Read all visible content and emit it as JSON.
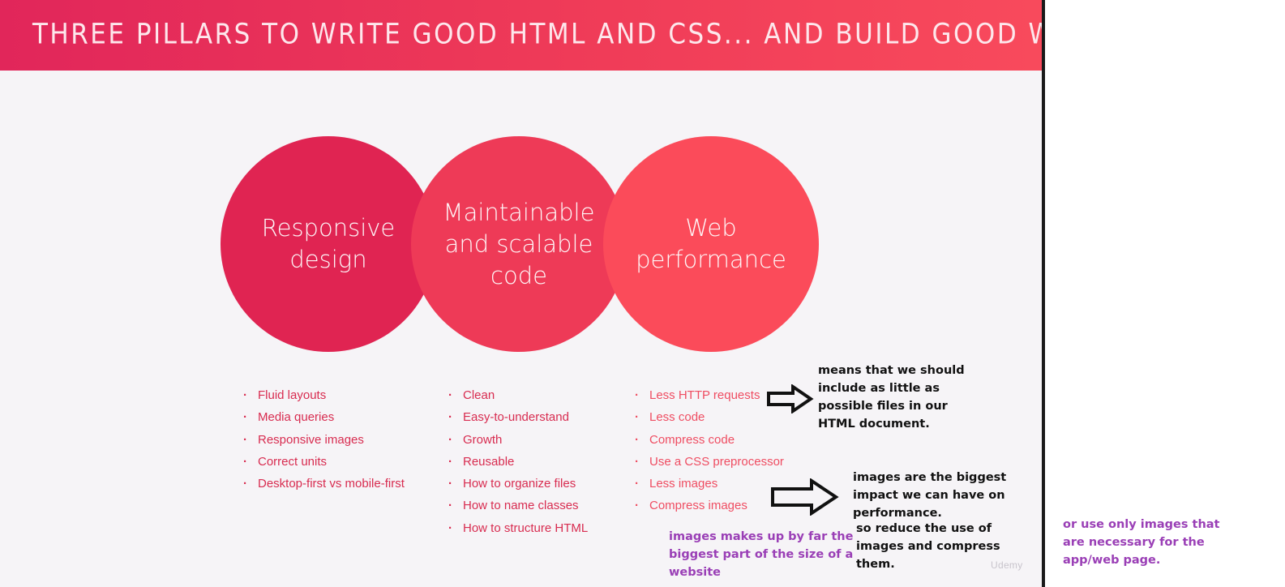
{
  "slide": {
    "title": "Three pillars to write good HTML and CSS... and build good websites",
    "watermark": "Udemy"
  },
  "pillars": [
    {
      "title": "Responsive\ndesign",
      "color": "#e02452",
      "items": [
        "Fluid layouts",
        "Media queries",
        "Responsive images",
        "Correct units",
        "Desktop-first vs mobile-first"
      ]
    },
    {
      "title": "Maintainable\nand scalable\ncode",
      "color": "#ee3a57",
      "items": [
        "Clean",
        "Easy-to-understand",
        "Growth",
        "Reusable",
        "How to organize files",
        "How to name classes",
        "How to structure HTML"
      ]
    },
    {
      "title": "Web\nperformance",
      "color": "#fb4b5a",
      "items": [
        "Less HTTP requests",
        "Less code",
        "Compress code",
        "Use a CSS preprocessor",
        "Less images",
        "Compress images"
      ]
    }
  ],
  "annotations": {
    "http_note": "means that we should\ninclude as little as\npossible files in our\nHTML document.",
    "images_note": "images are the biggest\nimpact we can have on\nperformance.",
    "reduce_note": "so reduce the use of\nimages and compress\nthem.",
    "size_note": "images makes up by far the\nbiggest part of the size of a\nwebsite",
    "necessary_note": "or use only images that\nare necessary for the\napp/web page."
  },
  "colors": {
    "header_start": "#e1265a",
    "header_end": "#f84a5c",
    "bullet_text": "#d82c50",
    "annotation_purple": "#9a3fb6"
  }
}
